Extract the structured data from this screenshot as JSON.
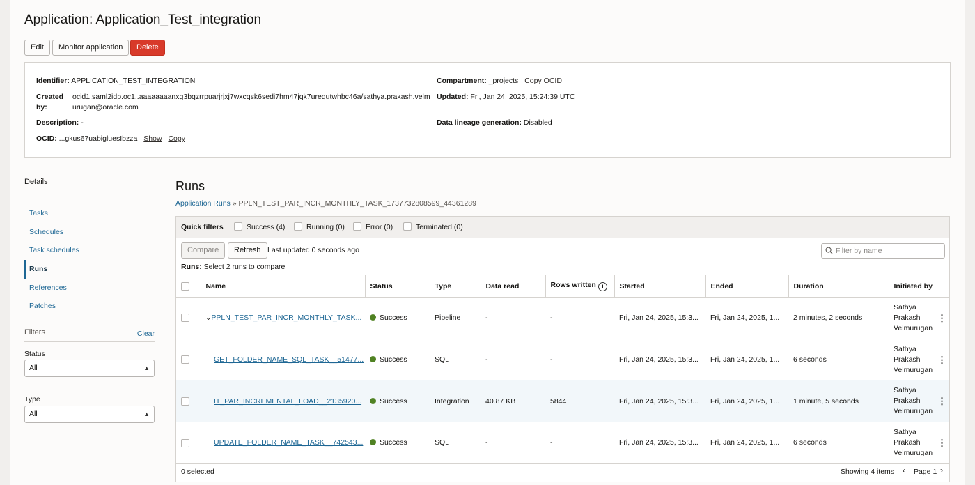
{
  "page": {
    "title": "Application: Application_Test_integration"
  },
  "actions": {
    "edit": "Edit",
    "monitor": "Monitor application",
    "delete": "Delete"
  },
  "info": {
    "identifier_label": "Identifier:",
    "identifier_value": "APPLICATION_TEST_INTEGRATION",
    "created_label_1": "Created",
    "created_label_2": "by:",
    "created_value_1": "ocid1.saml2idp.oc1..aaaaaaaanxg3bqzrrpuarjrjxj7wxcqsk6sedi7hm47jqk7urequtwhbc46a/sathya.prakash.velm",
    "created_value_2": "urugan@oracle.com",
    "description_label": "Description:",
    "description_value": "-",
    "ocid_label": "OCID:",
    "ocid_value": "...gkus67uabigluesIbzza",
    "ocid_show": "Show",
    "ocid_copy": "Copy",
    "compartment_label": "Compartment:",
    "compartment_value": "_projects",
    "copy_ocid": "Copy OCID",
    "updated_label": "Updated:",
    "updated_value": "Fri, Jan 24, 2025, 15:24:39 UTC",
    "lineage_label": "Data lineage generation:",
    "lineage_value": "Disabled"
  },
  "sidebar": {
    "heading": "Details",
    "items": [
      {
        "label": "Tasks"
      },
      {
        "label": "Schedules"
      },
      {
        "label": "Task schedules"
      },
      {
        "label": "Runs"
      },
      {
        "label": "References"
      },
      {
        "label": "Patches"
      }
    ],
    "active": "Runs"
  },
  "filters": {
    "heading": "Filters",
    "clear": "Clear",
    "status_label": "Status",
    "status_value": "All",
    "type_label": "Type",
    "type_value": "All"
  },
  "runs": {
    "title": "Runs",
    "breadcrumb_link": "Application Runs",
    "breadcrumb_sep": "»",
    "breadcrumb_current": "PPLN_TEST_PAR_INCR_MONTHLY_TASK_1737732808599_44361289"
  },
  "quick_filters": {
    "label": "Quick filters",
    "items": [
      {
        "label": "Success (4)"
      },
      {
        "label": "Running (0)"
      },
      {
        "label": "Error (0)"
      },
      {
        "label": "Terminated (0)"
      }
    ]
  },
  "toolbar": {
    "compare": "Compare",
    "refresh": "Refresh",
    "last_updated": "Last updated 0 seconds ago",
    "filter_placeholder": "Filter by name",
    "runs_label": "Runs:",
    "runs_hint": "Select 2 runs to compare"
  },
  "table": {
    "columns": [
      "Name",
      "Status",
      "Type",
      "Data read",
      "Rows written",
      "Started",
      "Ended",
      "Duration",
      "Initiated by"
    ],
    "rows": [
      {
        "name": "PPLN_TEST_PAR_INCR_MONTHLY_TASK...",
        "status": "Success",
        "type": "Pipeline",
        "data_read": "-",
        "rows_written": "-",
        "started": "Fri, Jan 24, 2025, 15:3...",
        "ended": "Fri, Jan 24, 2025, 1...",
        "duration": "2 minutes, 2 seconds",
        "init1": "Sathya",
        "init2": "Prakash",
        "init3": "Velmurugan"
      },
      {
        "name": "GET_FOLDER_NAME_SQL_TASK__51477...",
        "status": "Success",
        "type": "SQL",
        "data_read": "-",
        "rows_written": "-",
        "started": "Fri, Jan 24, 2025, 15:3...",
        "ended": "Fri, Jan 24, 2025, 1...",
        "duration": "6 seconds",
        "init1": "Sathya",
        "init2": "Prakash",
        "init3": "Velmurugan"
      },
      {
        "name": "IT_PAR_INCREMENTAL_LOAD__2135920...",
        "status": "Success",
        "type": "Integration",
        "data_read": "40.87 KB",
        "rows_written": "5844",
        "started": "Fri, Jan 24, 2025, 15:3...",
        "ended": "Fri, Jan 24, 2025, 1...",
        "duration": "1 minute, 5 seconds",
        "init1": "Sathya",
        "init2": "Prakash",
        "init3": "Velmurugan"
      },
      {
        "name": "UPDATE_FOLDER_NAME_TASK__742543...",
        "status": "Success",
        "type": "SQL",
        "data_read": "-",
        "rows_written": "-",
        "started": "Fri, Jan 24, 2025, 15:3...",
        "ended": "Fri, Jan 24, 2025, 1...",
        "duration": "6 seconds",
        "init1": "Sathya",
        "init2": "Prakash",
        "init3": "Velmurugan"
      }
    ]
  },
  "footer": {
    "selected": "0 selected",
    "showing": "Showing 4 items",
    "page": "Page 1"
  },
  "colors": {
    "success": "#508223",
    "link": "#1e6794",
    "danger": "#d83a2a"
  }
}
